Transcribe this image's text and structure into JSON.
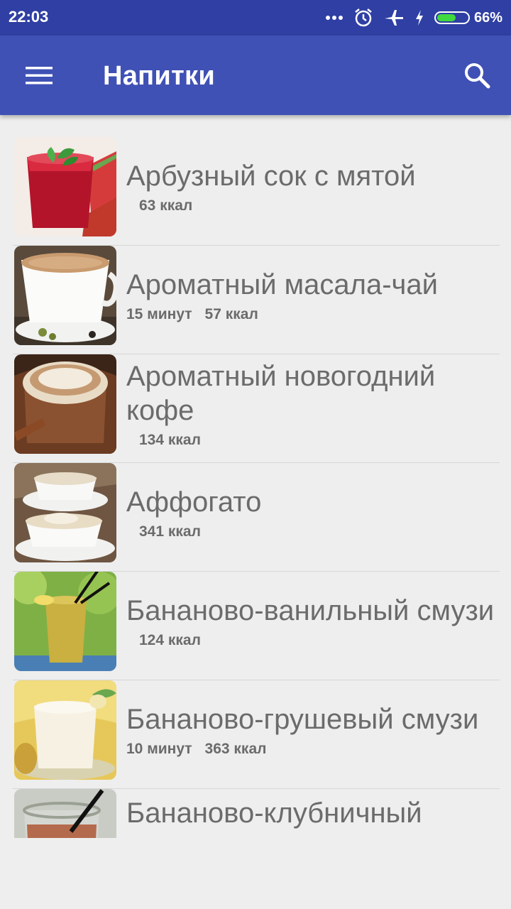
{
  "status_bar": {
    "time": "22:03",
    "battery_percent_label": "66%",
    "battery_level": 0.66,
    "icons": [
      "more-dots-icon",
      "alarm-icon",
      "airplane-mode-icon",
      "charging-icon",
      "battery-icon"
    ]
  },
  "app_bar": {
    "title": "Напитки",
    "menu_icon": "hamburger-menu-icon",
    "search_icon": "search-icon",
    "color": "#3f51b5"
  },
  "recipes": [
    {
      "title": "Арбузный сок с мятой",
      "time": "",
      "kcal": "63 ккал",
      "image": "watermelon-juice-photo"
    },
    {
      "title": "Ароматный масала-чай",
      "time": "15 минут",
      "kcal": "57 ккал",
      "image": "masala-chai-photo"
    },
    {
      "title": "Ароматный новогодний кофе",
      "time": "",
      "kcal": "134 ккал",
      "image": "holiday-coffee-photo"
    },
    {
      "title": "Аффогато",
      "time": "",
      "kcal": "341 ккал",
      "image": "affogato-photo"
    },
    {
      "title": "Бананово-ванильный смузи",
      "time": "",
      "kcal": "124 ккал",
      "image": "banana-vanilla-smoothie-photo"
    },
    {
      "title": "Бананово-грушевый смузи",
      "time": "10 минут",
      "kcal": "363 ккал",
      "image": "banana-pear-smoothie-photo"
    },
    {
      "title": "Бананово-клубничный",
      "time": "",
      "kcal": "",
      "image": "banana-strawberry-photo"
    }
  ]
}
